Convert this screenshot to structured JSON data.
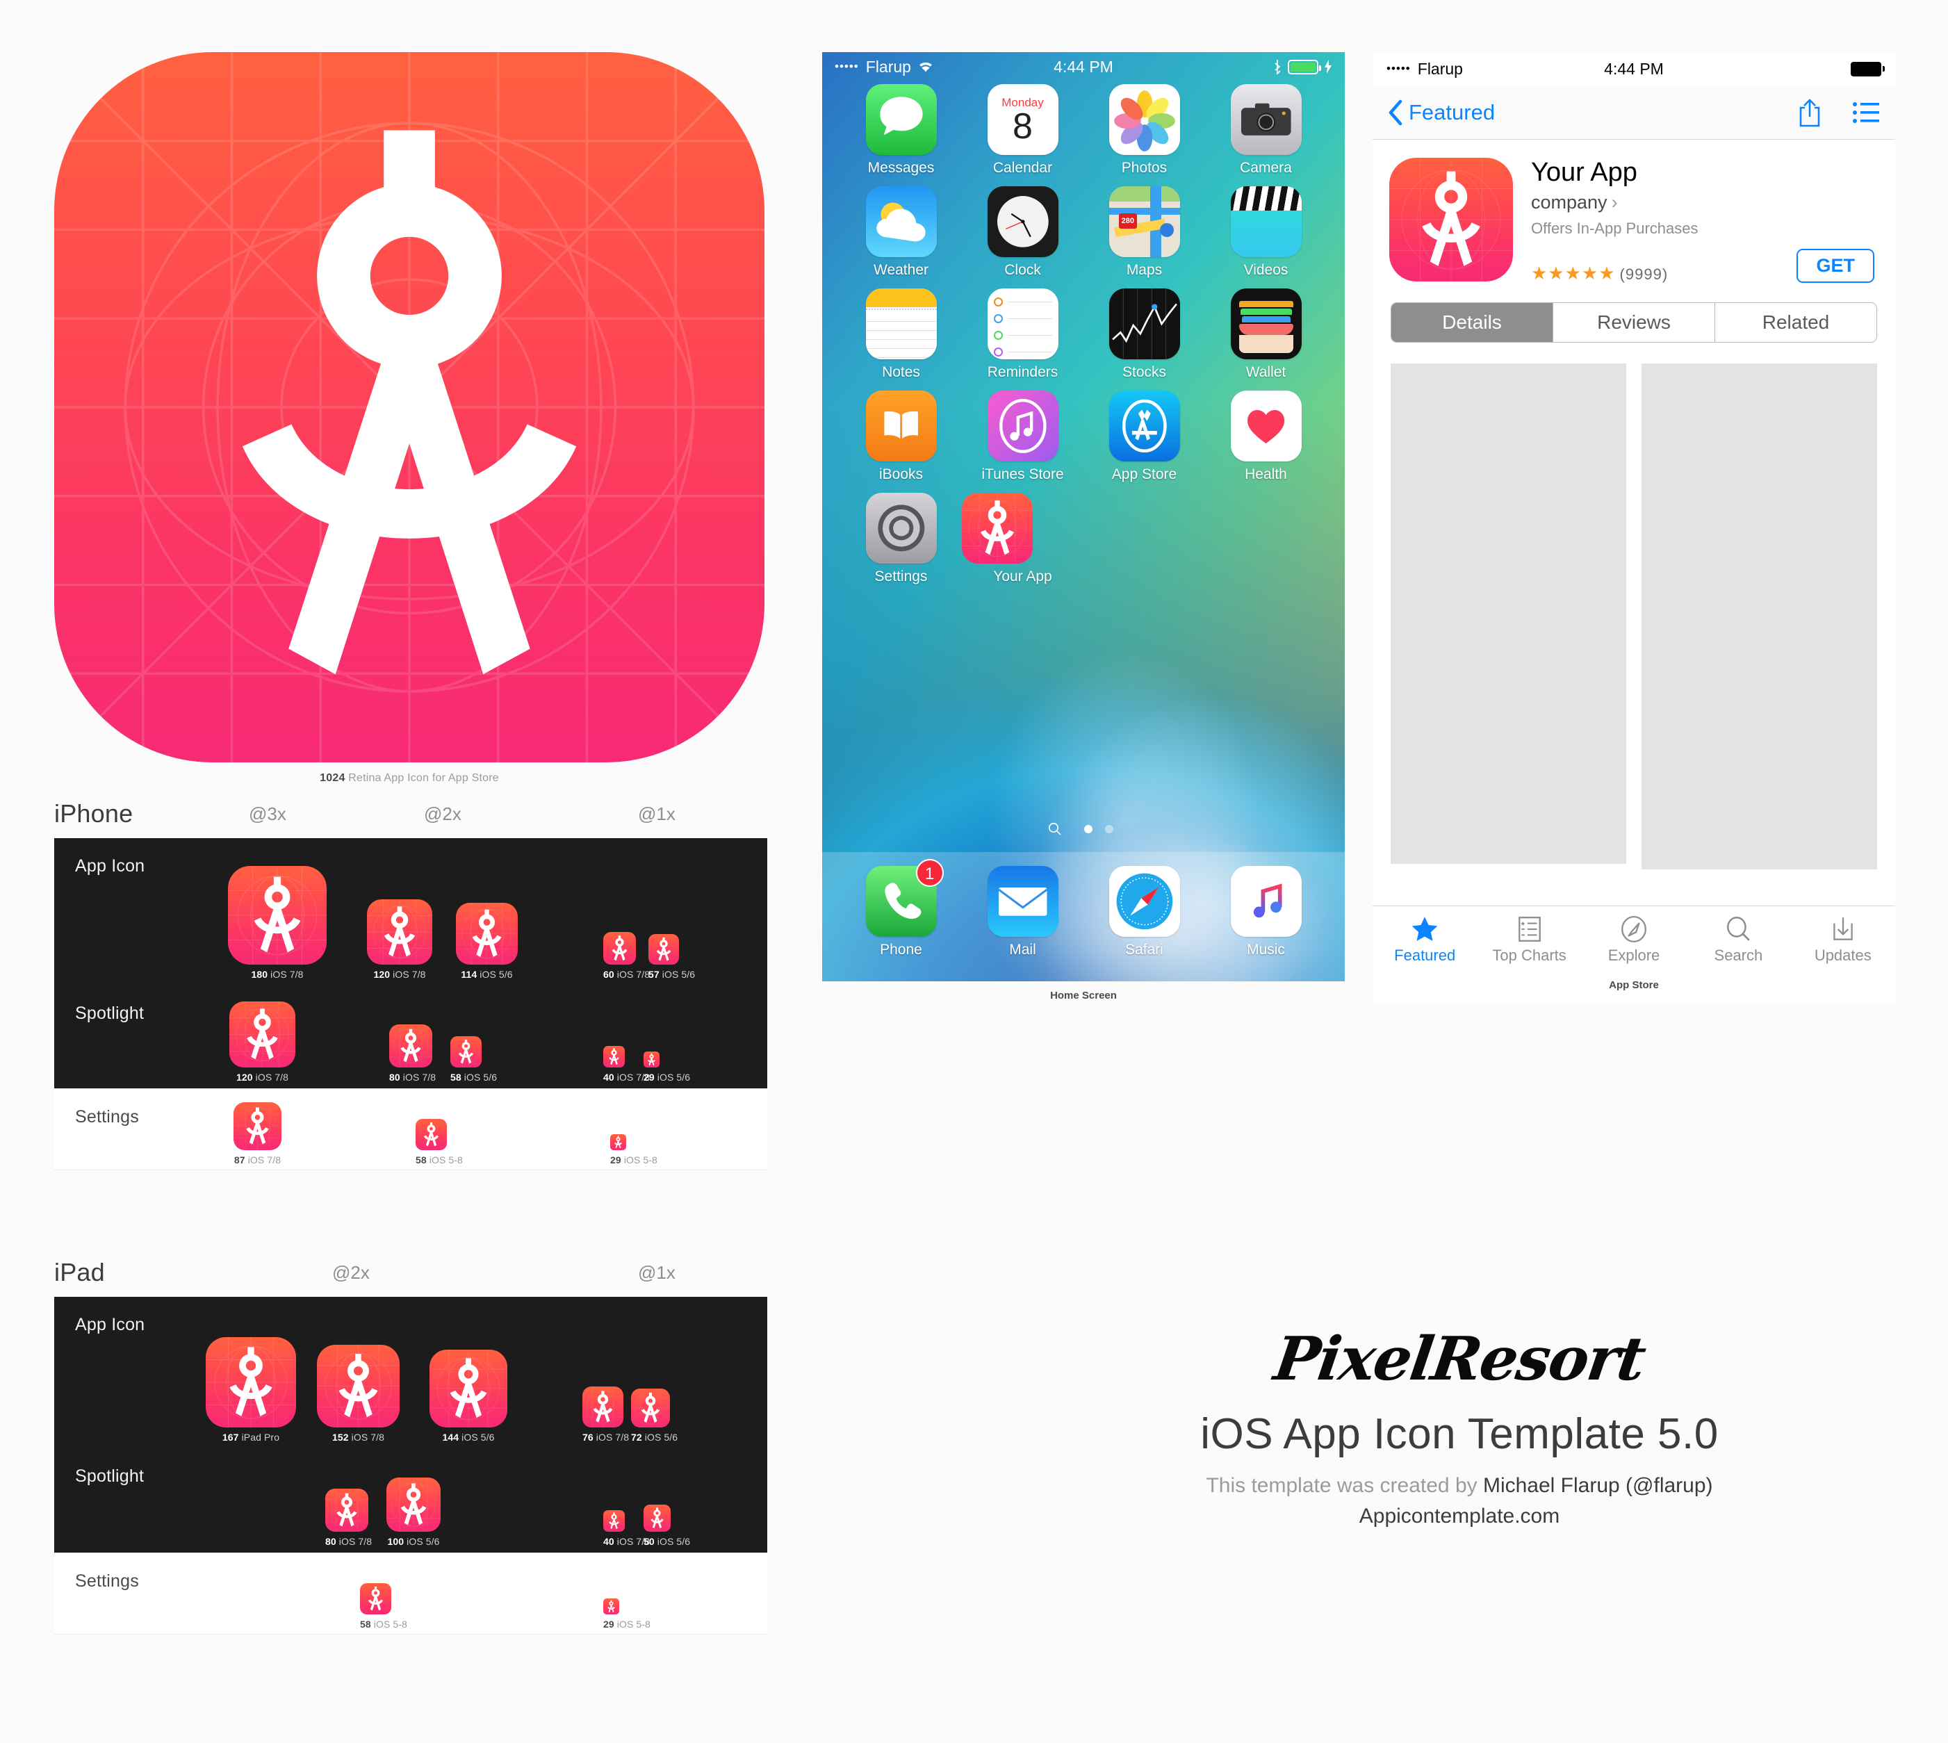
{
  "hero": {
    "caption_size": "1024",
    "caption_text": " Retina App Icon for App Store"
  },
  "sections": [
    {
      "device": "iPhone",
      "scales": [
        "@3x",
        "@2x",
        "@1x"
      ],
      "rows": [
        {
          "label": "App Icon",
          "theme": "dark",
          "items": [
            {
              "px": "180",
              "os": "iOS 7/8"
            },
            {
              "px": "120",
              "os": "iOS 7/8"
            },
            {
              "px": "114",
              "os": "iOS 5/6"
            },
            {
              "px": "60",
              "os": "iOS 7/8"
            },
            {
              "px": "57",
              "os": "iOS 5/6"
            }
          ]
        },
        {
          "label": "Spotlight",
          "theme": "dark",
          "items": [
            {
              "px": "120",
              "os": "iOS 7/8"
            },
            {
              "px": "80",
              "os": "iOS 7/8"
            },
            {
              "px": "58",
              "os": "iOS 5/6"
            },
            {
              "px": "40",
              "os": "iOS 7/8"
            },
            {
              "px": "29",
              "os": "iOS 5/6"
            }
          ]
        },
        {
          "label": "Settings",
          "theme": "light",
          "items": [
            {
              "px": "87",
              "os": "iOS 7/8"
            },
            {
              "px": "58",
              "os": "iOS 5-8"
            },
            {
              "px": "29",
              "os": "iOS 5-8"
            }
          ]
        }
      ]
    },
    {
      "device": "iPad",
      "scales": [
        "@2x",
        "@1x"
      ],
      "rows": [
        {
          "label": "App Icon",
          "theme": "dark",
          "items": [
            {
              "px": "167",
              "os": "iPad Pro"
            },
            {
              "px": "152",
              "os": "iOS 7/8"
            },
            {
              "px": "144",
              "os": "iOS 5/6"
            },
            {
              "px": "76",
              "os": "iOS 7/8"
            },
            {
              "px": "72",
              "os": "iOS 5/6"
            }
          ]
        },
        {
          "label": "Spotlight",
          "theme": "dark",
          "items": [
            {
              "px": "80",
              "os": "iOS 7/8"
            },
            {
              "px": "100",
              "os": "iOS 5/6"
            },
            {
              "px": "40",
              "os": "iOS 7/8"
            },
            {
              "px": "50",
              "os": "iOS 5/6"
            }
          ]
        },
        {
          "label": "Settings",
          "theme": "light",
          "items": [
            {
              "px": "58",
              "os": "iOS 5-8"
            },
            {
              "px": "29",
              "os": "iOS 5-8"
            }
          ]
        }
      ]
    }
  ],
  "homescreen": {
    "caption": "Home Screen",
    "status": {
      "signal": "•••••",
      "carrier": "Flarup",
      "wifi": "wifi-icon",
      "time": "4:44 PM",
      "bluetooth": "bluetooth-icon",
      "battery": "battery-icon",
      "charging": "charging-icon"
    },
    "apps": [
      {
        "name": "Messages"
      },
      {
        "name": "Calendar",
        "day": "Monday",
        "date": "8"
      },
      {
        "name": "Photos"
      },
      {
        "name": "Camera"
      },
      {
        "name": "Weather"
      },
      {
        "name": "Clock"
      },
      {
        "name": "Maps",
        "route": "280"
      },
      {
        "name": "Videos"
      },
      {
        "name": "Notes"
      },
      {
        "name": "Reminders"
      },
      {
        "name": "Stocks"
      },
      {
        "name": "Wallet"
      },
      {
        "name": "iBooks"
      },
      {
        "name": "iTunes Store"
      },
      {
        "name": "App Store"
      },
      {
        "name": "Health"
      },
      {
        "name": "Settings"
      },
      {
        "name": "Your App"
      }
    ],
    "dock": [
      {
        "name": "Phone",
        "badge": "1"
      },
      {
        "name": "Mail"
      },
      {
        "name": "Safari"
      },
      {
        "name": "Music"
      }
    ]
  },
  "appstore": {
    "caption": "App Store",
    "status": {
      "signal": "•••••",
      "carrier": "Flarup",
      "time": "4:44 PM"
    },
    "nav": {
      "back_label": "Featured",
      "share_icon": "share-icon",
      "list_icon": "list-icon"
    },
    "app": {
      "title": "Your App",
      "company": "company",
      "chevron": "›",
      "iap": "Offers In-App Purchases",
      "stars": "★★★★★",
      "rating_count": "(9999)",
      "get_label": "GET"
    },
    "tabs": [
      {
        "label": "Details",
        "active": true
      },
      {
        "label": "Reviews",
        "active": false
      },
      {
        "label": "Related",
        "active": false
      }
    ],
    "tabbar": [
      {
        "label": "Featured",
        "icon": "star-icon",
        "active": true
      },
      {
        "label": "Top Charts",
        "icon": "charts-icon",
        "active": false
      },
      {
        "label": "Explore",
        "icon": "compass-icon",
        "active": false
      },
      {
        "label": "Search",
        "icon": "search-icon",
        "active": false
      },
      {
        "label": "Updates",
        "icon": "download-icon",
        "active": false
      }
    ]
  },
  "branding": {
    "logo": "PixelResort",
    "title": "iOS App Icon Template 5.0",
    "credit_prefix": "This template was created by ",
    "credit_author": "Michael Flarup (@flarup)",
    "website": "Appicontemplate.com"
  },
  "colors": {
    "icon_top": "#ff6140",
    "icon_bottom": "#f72a75",
    "accent_blue": "#0a84ff",
    "star_gold": "#f79a1f",
    "dark_panel": "#1c1c1c"
  }
}
